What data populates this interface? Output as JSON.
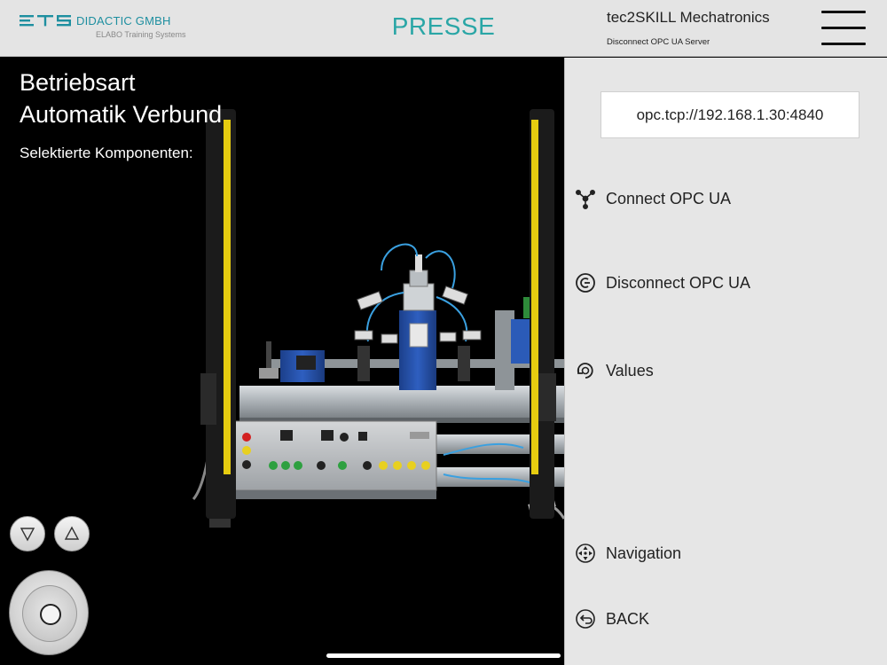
{
  "header": {
    "company": "DIDACTIC GMBH",
    "company_sub": "ELABO Training Systems",
    "title": "PRESSE",
    "product": "tec2SKILL Mechatronics",
    "status": "Disconnect OPC UA Server",
    "brand_color": "#1e8fa0",
    "title_color": "#2aa6a6"
  },
  "viewport": {
    "mode_line1": "Betriebsart",
    "mode_line2": "Automatik Verbund",
    "components_label": "Selektierte Komponenten:",
    "controls": {
      "down_icon": "triangle-down-icon",
      "up_icon": "triangle-up-icon",
      "joystick_icon": "joystick-icon"
    }
  },
  "panel": {
    "server_url": "opc.tcp://192.168.1.30:4840",
    "items": [
      {
        "label": "Connect OPC UA",
        "icon": "network-icon"
      },
      {
        "label": "Disconnect OPC UA",
        "icon": "disconnect-icon"
      },
      {
        "label": "Values",
        "icon": "values-icon"
      },
      {
        "label": "Navigation",
        "icon": "navigation-icon"
      },
      {
        "label": "BACK",
        "icon": "back-icon"
      }
    ]
  }
}
